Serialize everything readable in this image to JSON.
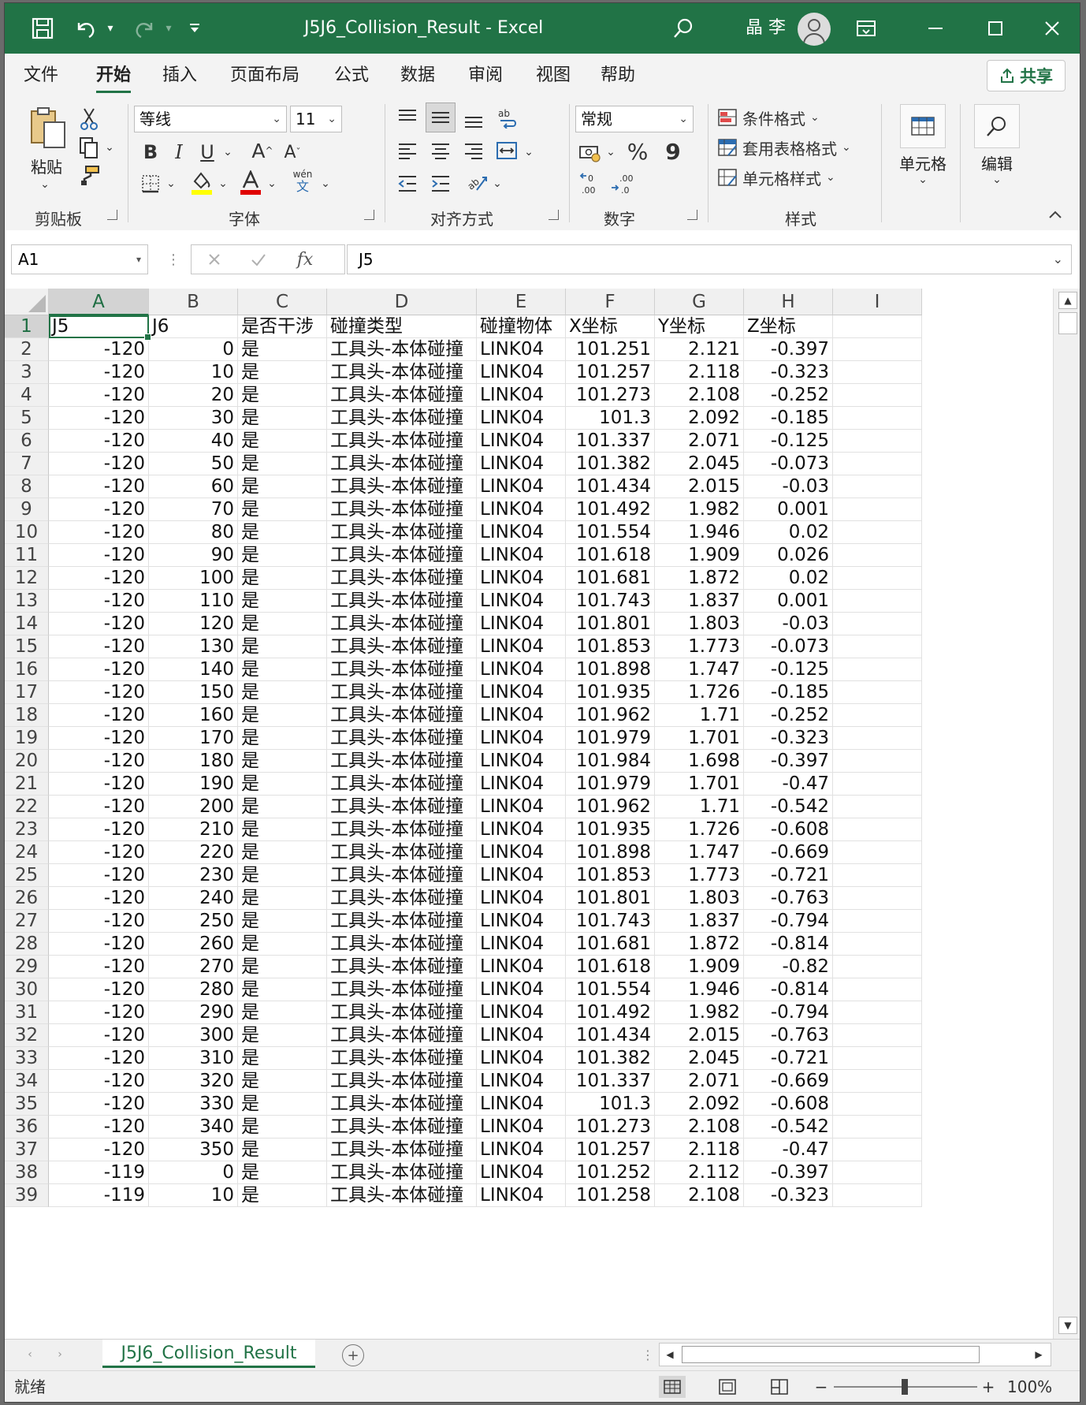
{
  "title": {
    "text": "J5J6_Collision_Result  -  Excel",
    "user": "晶 李"
  },
  "tabs": [
    "文件",
    "开始",
    "插入",
    "页面布局",
    "公式",
    "数据",
    "审阅",
    "视图",
    "帮助"
  ],
  "active_tab": "开始",
  "share_label": "共享",
  "ribbon": {
    "clipboard": {
      "paste": "粘贴",
      "group": "剪贴板"
    },
    "font": {
      "name": "等线",
      "size": "11",
      "group": "字体",
      "pinyin": "wén",
      "pinyin_char": "文"
    },
    "alignment": {
      "group": "对齐方式"
    },
    "number": {
      "format": "常规",
      "group": "数字",
      "percent": "%",
      "comma": "9"
    },
    "styles": {
      "conditional": "条件格式",
      "table": "套用表格格式",
      "cell": "单元格样式",
      "group": "样式"
    },
    "cells": {
      "label": "单元格"
    },
    "editing": {
      "label": "编辑"
    }
  },
  "formula_bar": {
    "name_box": "A1",
    "formula": "J5",
    "fx": "fx"
  },
  "columns": [
    "A",
    "B",
    "C",
    "D",
    "E",
    "F",
    "G",
    "H",
    "I"
  ],
  "rows": [
    [
      "J5",
      "J6",
      "是否干涉",
      "碰撞类型",
      "碰撞物体",
      "X坐标",
      "Y坐标",
      "Z坐标"
    ],
    [
      "-120",
      "0",
      "是",
      "工具头-本体碰撞",
      "LINK04",
      "101.251",
      "2.121",
      "-0.397"
    ],
    [
      "-120",
      "10",
      "是",
      "工具头-本体碰撞",
      "LINK04",
      "101.257",
      "2.118",
      "-0.323"
    ],
    [
      "-120",
      "20",
      "是",
      "工具头-本体碰撞",
      "LINK04",
      "101.273",
      "2.108",
      "-0.252"
    ],
    [
      "-120",
      "30",
      "是",
      "工具头-本体碰撞",
      "LINK04",
      "101.3",
      "2.092",
      "-0.185"
    ],
    [
      "-120",
      "40",
      "是",
      "工具头-本体碰撞",
      "LINK04",
      "101.337",
      "2.071",
      "-0.125"
    ],
    [
      "-120",
      "50",
      "是",
      "工具头-本体碰撞",
      "LINK04",
      "101.382",
      "2.045",
      "-0.073"
    ],
    [
      "-120",
      "60",
      "是",
      "工具头-本体碰撞",
      "LINK04",
      "101.434",
      "2.015",
      "-0.03"
    ],
    [
      "-120",
      "70",
      "是",
      "工具头-本体碰撞",
      "LINK04",
      "101.492",
      "1.982",
      "0.001"
    ],
    [
      "-120",
      "80",
      "是",
      "工具头-本体碰撞",
      "LINK04",
      "101.554",
      "1.946",
      "0.02"
    ],
    [
      "-120",
      "90",
      "是",
      "工具头-本体碰撞",
      "LINK04",
      "101.618",
      "1.909",
      "0.026"
    ],
    [
      "-120",
      "100",
      "是",
      "工具头-本体碰撞",
      "LINK04",
      "101.681",
      "1.872",
      "0.02"
    ],
    [
      "-120",
      "110",
      "是",
      "工具头-本体碰撞",
      "LINK04",
      "101.743",
      "1.837",
      "0.001"
    ],
    [
      "-120",
      "120",
      "是",
      "工具头-本体碰撞",
      "LINK04",
      "101.801",
      "1.803",
      "-0.03"
    ],
    [
      "-120",
      "130",
      "是",
      "工具头-本体碰撞",
      "LINK04",
      "101.853",
      "1.773",
      "-0.073"
    ],
    [
      "-120",
      "140",
      "是",
      "工具头-本体碰撞",
      "LINK04",
      "101.898",
      "1.747",
      "-0.125"
    ],
    [
      "-120",
      "150",
      "是",
      "工具头-本体碰撞",
      "LINK04",
      "101.935",
      "1.726",
      "-0.185"
    ],
    [
      "-120",
      "160",
      "是",
      "工具头-本体碰撞",
      "LINK04",
      "101.962",
      "1.71",
      "-0.252"
    ],
    [
      "-120",
      "170",
      "是",
      "工具头-本体碰撞",
      "LINK04",
      "101.979",
      "1.701",
      "-0.323"
    ],
    [
      "-120",
      "180",
      "是",
      "工具头-本体碰撞",
      "LINK04",
      "101.984",
      "1.698",
      "-0.397"
    ],
    [
      "-120",
      "190",
      "是",
      "工具头-本体碰撞",
      "LINK04",
      "101.979",
      "1.701",
      "-0.47"
    ],
    [
      "-120",
      "200",
      "是",
      "工具头-本体碰撞",
      "LINK04",
      "101.962",
      "1.71",
      "-0.542"
    ],
    [
      "-120",
      "210",
      "是",
      "工具头-本体碰撞",
      "LINK04",
      "101.935",
      "1.726",
      "-0.608"
    ],
    [
      "-120",
      "220",
      "是",
      "工具头-本体碰撞",
      "LINK04",
      "101.898",
      "1.747",
      "-0.669"
    ],
    [
      "-120",
      "230",
      "是",
      "工具头-本体碰撞",
      "LINK04",
      "101.853",
      "1.773",
      "-0.721"
    ],
    [
      "-120",
      "240",
      "是",
      "工具头-本体碰撞",
      "LINK04",
      "101.801",
      "1.803",
      "-0.763"
    ],
    [
      "-120",
      "250",
      "是",
      "工具头-本体碰撞",
      "LINK04",
      "101.743",
      "1.837",
      "-0.794"
    ],
    [
      "-120",
      "260",
      "是",
      "工具头-本体碰撞",
      "LINK04",
      "101.681",
      "1.872",
      "-0.814"
    ],
    [
      "-120",
      "270",
      "是",
      "工具头-本体碰撞",
      "LINK04",
      "101.618",
      "1.909",
      "-0.82"
    ],
    [
      "-120",
      "280",
      "是",
      "工具头-本体碰撞",
      "LINK04",
      "101.554",
      "1.946",
      "-0.814"
    ],
    [
      "-120",
      "290",
      "是",
      "工具头-本体碰撞",
      "LINK04",
      "101.492",
      "1.982",
      "-0.794"
    ],
    [
      "-120",
      "300",
      "是",
      "工具头-本体碰撞",
      "LINK04",
      "101.434",
      "2.015",
      "-0.763"
    ],
    [
      "-120",
      "310",
      "是",
      "工具头-本体碰撞",
      "LINK04",
      "101.382",
      "2.045",
      "-0.721"
    ],
    [
      "-120",
      "320",
      "是",
      "工具头-本体碰撞",
      "LINK04",
      "101.337",
      "2.071",
      "-0.669"
    ],
    [
      "-120",
      "330",
      "是",
      "工具头-本体碰撞",
      "LINK04",
      "101.3",
      "2.092",
      "-0.608"
    ],
    [
      "-120",
      "340",
      "是",
      "工具头-本体碰撞",
      "LINK04",
      "101.273",
      "2.108",
      "-0.542"
    ],
    [
      "-120",
      "350",
      "是",
      "工具头-本体碰撞",
      "LINK04",
      "101.257",
      "2.118",
      "-0.47"
    ],
    [
      "-119",
      "0",
      "是",
      "工具头-本体碰撞",
      "LINK04",
      "101.252",
      "2.112",
      "-0.397"
    ],
    [
      "-119",
      "10",
      "是",
      "工具头-本体碰撞",
      "LINK04",
      "101.258",
      "2.108",
      "-0.323"
    ]
  ],
  "sheet_tab": "J5J6_Collision_Result",
  "status": {
    "ready": "就绪",
    "zoom": "100%"
  },
  "colors": {
    "accent": "#217346",
    "title_bar": "#217346"
  }
}
